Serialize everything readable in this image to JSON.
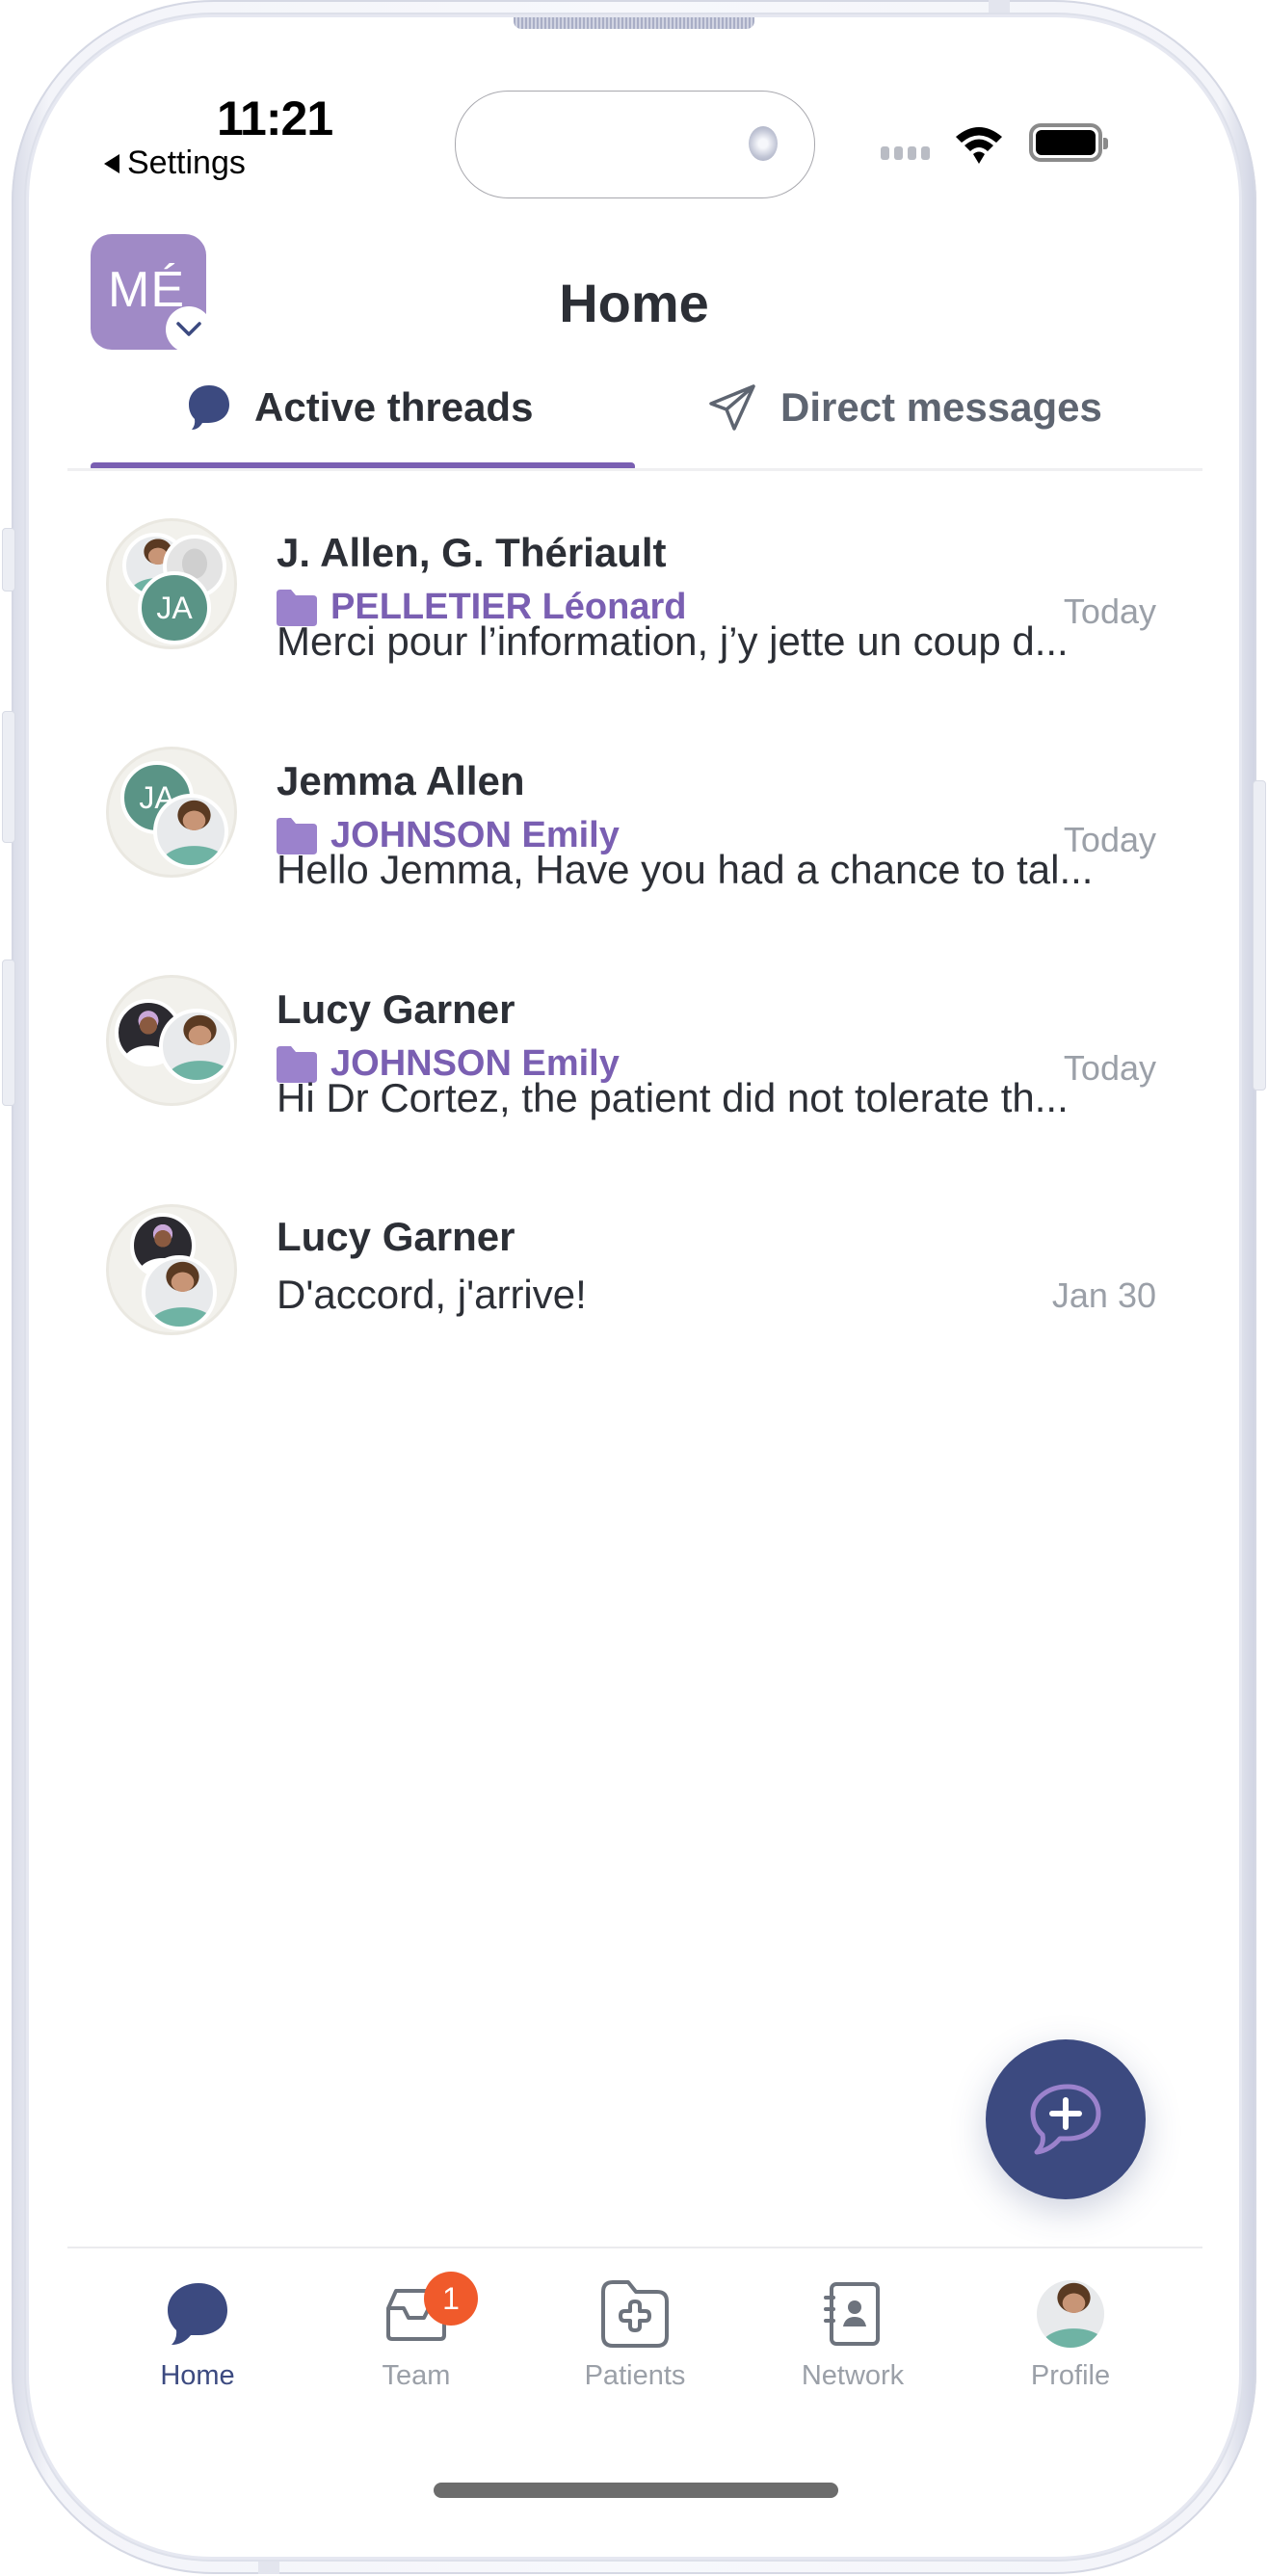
{
  "status_bar": {
    "time": "11:21",
    "back_label": "Settings"
  },
  "header": {
    "org_initials": "MÉ",
    "title": "Home"
  },
  "tabs": [
    {
      "label": "Active threads",
      "icon": "chat-bubble-icon",
      "active": true
    },
    {
      "label": "Direct messages",
      "icon": "paper-plane-icon",
      "active": false
    }
  ],
  "colors": {
    "accent_purple": "#7a5fb2",
    "org_avatar": "#a08ac6",
    "navy": "#3c4a80",
    "badge_orange": "#f05a2b",
    "initials_green": "#5a9486",
    "muted_text": "#9ba0a8"
  },
  "threads": [
    {
      "name": "J. Allen, G. Thériault",
      "patient": "PELLETIER Léonard",
      "time": "Today",
      "preview": "Merci pour l’information, j’y jette un coup d...",
      "avatar_initials": "JA"
    },
    {
      "name": "Jemma Allen",
      "patient": "JOHNSON Emily",
      "time": "Today",
      "preview": "Hello Jemma, Have you had a chance to tal...",
      "avatar_initials": "JA"
    },
    {
      "name": "Lucy Garner",
      "patient": "JOHNSON Emily",
      "time": "Today",
      "preview": "Hi Dr Cortez, the patient did not tolerate th..."
    },
    {
      "name": "Lucy Garner",
      "time": "Jan 30",
      "preview": "D'accord, j'arrive!"
    }
  ],
  "fab": {
    "icon": "new-message-icon"
  },
  "tab_bar": [
    {
      "label": "Home",
      "icon": "chat-bubble-icon",
      "active": true
    },
    {
      "label": "Team",
      "icon": "inbox-icon",
      "badge": "1"
    },
    {
      "label": "Patients",
      "icon": "folder-plus-icon"
    },
    {
      "label": "Network",
      "icon": "contact-book-icon"
    },
    {
      "label": "Profile",
      "icon": "profile-avatar"
    }
  ]
}
